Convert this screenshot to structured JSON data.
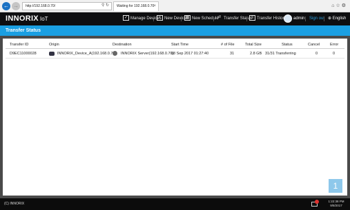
{
  "browser": {
    "url": "http://192.168.0.70/",
    "tab_title": "Waiting for 192.168.0.70"
  },
  "app": {
    "logo": "INNORIX",
    "logo_suffix": "IoT",
    "menu": [
      {
        "label": "Manage Devices",
        "icon": "checkbox-icon"
      },
      {
        "label": "New Device",
        "icon": "monitor-icon"
      },
      {
        "label": "New Schedule",
        "icon": "calendar-icon"
      },
      {
        "label": "Transfer Status",
        "icon": "transfer-icon"
      },
      {
        "label": "Transfer History",
        "icon": "history-icon"
      }
    ],
    "user": "admin",
    "signout": "Sign out",
    "language": "English"
  },
  "page": {
    "title": "Transfer Status"
  },
  "table": {
    "columns": [
      "Transfer ID",
      "Origin",
      "Destination",
      "Start Time",
      "# of File",
      "Total Size",
      "Status",
      "Cancel",
      "Error"
    ],
    "rows": [
      {
        "transfer_id": "D9EC11000028",
        "origin": "INNORIX_Device_A(192.168.0.73)",
        "destination": "INNORIX Server(192.168.0.70)",
        "start_time": "08 Sep 2017 01:27:40",
        "files": "31",
        "total_size": "2.8 GB",
        "status": "31/31 Transferring",
        "cancel": "0",
        "error": "0"
      }
    ]
  },
  "pagination": {
    "current_page": "1"
  },
  "footer": {
    "copyright": "(C) INNORIX"
  },
  "taskbar": {
    "time": "1:22:38 PM",
    "date": "9/8/2017"
  },
  "colors": {
    "accent": "#1a9fe2",
    "header_bg": "#0e0e10",
    "signout": "#2aa0e0"
  }
}
